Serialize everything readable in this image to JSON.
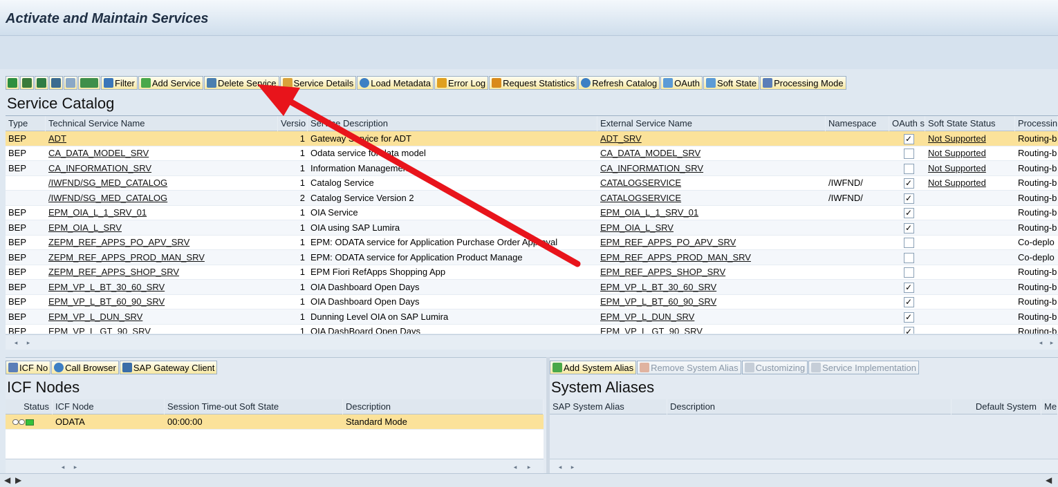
{
  "window": {
    "title": "Activate and Maintain Services"
  },
  "toolbar": {
    "buttons": [
      {
        "label": "Filter",
        "icon": "filter-icon"
      },
      {
        "label": "Add Service",
        "icon": "add-icon"
      },
      {
        "label": "Delete Service",
        "icon": "trash-icon"
      },
      {
        "label": "Service Details",
        "icon": "details-icon"
      },
      {
        "label": "Load Metadata",
        "icon": "refresh-icon"
      },
      {
        "label": "Error Log",
        "icon": "error-log-icon"
      },
      {
        "label": "Request Statistics",
        "icon": "statistics-icon"
      },
      {
        "label": "Refresh Catalog",
        "icon": "refresh-icon"
      },
      {
        "label": "OAuth",
        "icon": "oauth-icon"
      },
      {
        "label": "Soft State",
        "icon": "soft-state-icon"
      },
      {
        "label": "Processing Mode",
        "icon": "pencil-icon"
      }
    ]
  },
  "catalog": {
    "title": "Service Catalog",
    "columns": [
      "Type",
      "Technical Service Name",
      "Versio",
      "Service Description",
      "External Service Name",
      "Namespace",
      "OAuth s",
      "Soft State Status",
      "Processin"
    ],
    "rows": [
      {
        "type": "BEP",
        "name": "ADT",
        "ver": "1",
        "desc": "Gateway Service for ADT",
        "ext": "ADT_SRV",
        "ns": "",
        "oauth": true,
        "soft": "Not Supported",
        "proc": "Routing-b"
      },
      {
        "type": "BEP",
        "name": "CA_DATA_MODEL_SRV",
        "ver": "1",
        "desc": "Odata service for data model",
        "ext": "CA_DATA_MODEL_SRV",
        "ns": "",
        "oauth": false,
        "soft": "Not Supported",
        "proc": "Routing-b"
      },
      {
        "type": "BEP",
        "name": "CA_INFORMATION_SRV",
        "ver": "1",
        "desc": "Information Management",
        "ext": "CA_INFORMATION_SRV",
        "ns": "",
        "oauth": false,
        "soft": "Not Supported",
        "proc": "Routing-b"
      },
      {
        "type": "",
        "name": "/IWFND/SG_MED_CATALOG",
        "ver": "1",
        "desc": "Catalog Service",
        "ext": "CATALOGSERVICE",
        "ns": "/IWFND/",
        "oauth": true,
        "soft": "Not Supported",
        "proc": "Routing-b"
      },
      {
        "type": "",
        "name": "/IWFND/SG_MED_CATALOG",
        "ver": "2",
        "desc": "Catalog Service Version 2",
        "ext": "CATALOGSERVICE",
        "ns": "/IWFND/",
        "oauth": true,
        "soft": "",
        "proc": "Routing-b"
      },
      {
        "type": "BEP",
        "name": "EPM_OIA_L_1_SRV_01",
        "ver": "1",
        "desc": "OIA Service",
        "ext": "EPM_OIA_L_1_SRV_01",
        "ns": "",
        "oauth": true,
        "soft": "",
        "proc": "Routing-b"
      },
      {
        "type": "BEP",
        "name": "EPM_OIA_L_SRV",
        "ver": "1",
        "desc": "OIA using SAP Lumira",
        "ext": "EPM_OIA_L_SRV",
        "ns": "",
        "oauth": true,
        "soft": "",
        "proc": "Routing-b"
      },
      {
        "type": "BEP",
        "name": "ZEPM_REF_APPS_PO_APV_SRV",
        "ver": "1",
        "desc": "EPM: ODATA service for Application Purchase Order Approval",
        "ext": "EPM_REF_APPS_PO_APV_SRV",
        "ns": "",
        "oauth": false,
        "soft": "",
        "proc": "Co-deplo"
      },
      {
        "type": "BEP",
        "name": "ZEPM_REF_APPS_PROD_MAN_SRV",
        "ver": "1",
        "desc": "EPM: ODATA service for Application Product Manage",
        "ext": "EPM_REF_APPS_PROD_MAN_SRV",
        "ns": "",
        "oauth": false,
        "soft": "",
        "proc": "Co-deplo"
      },
      {
        "type": "BEP",
        "name": "ZEPM_REF_APPS_SHOP_SRV",
        "ver": "1",
        "desc": "EPM Fiori RefApps Shopping App",
        "ext": "EPM_REF_APPS_SHOP_SRV",
        "ns": "",
        "oauth": false,
        "soft": "",
        "proc": "Routing-b"
      },
      {
        "type": "BEP",
        "name": "EPM_VP_L_BT_30_60_SRV",
        "ver": "1",
        "desc": "OIA Dashboard Open Days",
        "ext": "EPM_VP_L_BT_30_60_SRV",
        "ns": "",
        "oauth": true,
        "soft": "",
        "proc": "Routing-b"
      },
      {
        "type": "BEP",
        "name": "EPM_VP_L_BT_60_90_SRV",
        "ver": "1",
        "desc": "OIA Dashboard Open Days",
        "ext": "EPM_VP_L_BT_60_90_SRV",
        "ns": "",
        "oauth": true,
        "soft": "",
        "proc": "Routing-b"
      },
      {
        "type": "BEP",
        "name": "EPM_VP_L_DUN_SRV",
        "ver": "1",
        "desc": "Dunning Level OIA on SAP Lumira",
        "ext": "EPM_VP_L_DUN_SRV",
        "ns": "",
        "oauth": true,
        "soft": "",
        "proc": "Routing-b"
      },
      {
        "type": "BEP",
        "name": "EPM_VP_L_GT_90_SRV",
        "ver": "1",
        "desc": "OIA DashBoard Open Days",
        "ext": "EPM_VP_L_GT_90_SRV",
        "ns": "",
        "oauth": true,
        "soft": "",
        "proc": "Routing-b"
      }
    ]
  },
  "icf": {
    "toolbar": [
      "ICF No",
      "Call Browser",
      "SAP Gateway Client"
    ],
    "title": "ICF Nodes",
    "columns": [
      "Status",
      "ICF Node",
      "Session Time-out Soft State",
      "Description"
    ],
    "rows": [
      {
        "status": "active",
        "node": "ODATA",
        "timeout": "00:00:00",
        "desc": "Standard Mode"
      }
    ]
  },
  "aliases": {
    "toolbar": [
      {
        "label": "Add System Alias",
        "enabled": true
      },
      {
        "label": "Remove System Alias",
        "enabled": false
      },
      {
        "label": "Customizing",
        "enabled": false
      },
      {
        "label": "Service Implementation",
        "enabled": false
      }
    ],
    "title": "System Aliases",
    "columns": [
      "SAP System Alias",
      "Description",
      "Default System",
      "Me"
    ]
  },
  "colors": {
    "selected_row": "#fbe29a",
    "arrow": "#e8141b",
    "header_bg": "#dfe7ef"
  }
}
